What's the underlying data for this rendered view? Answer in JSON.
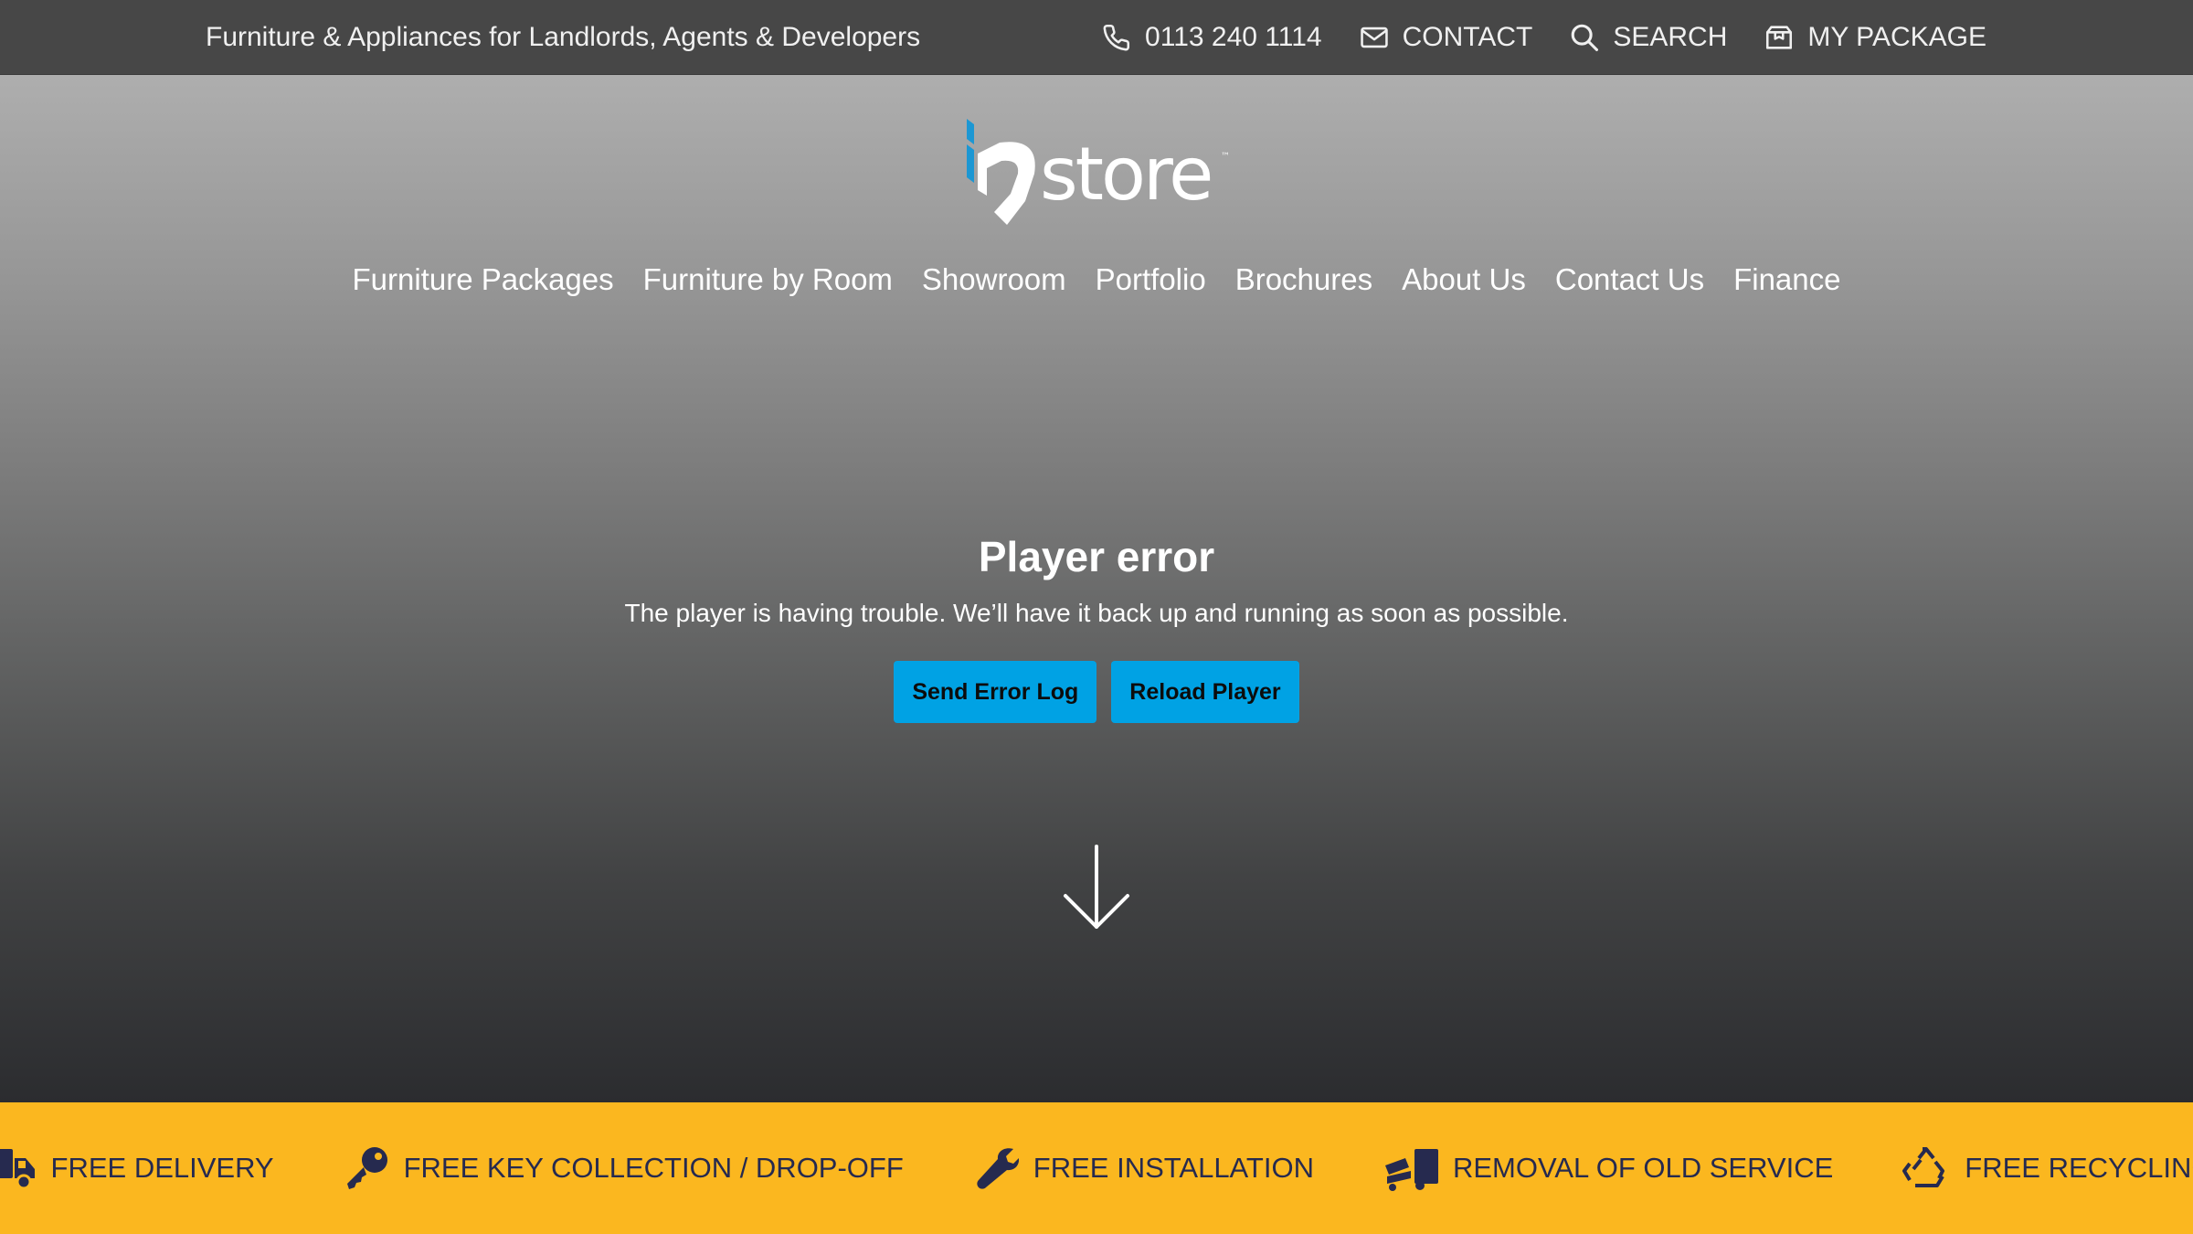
{
  "topbar": {
    "tagline": "Furniture & Appliances for Landlords, Agents & Developers",
    "phone": "0113 240 1114",
    "contact": "CONTACT",
    "search": "SEARCH",
    "package": "MY PACKAGE"
  },
  "logo": {
    "text": "store"
  },
  "nav": {
    "items": [
      "Furniture Packages",
      "Furniture by Room",
      "Showroom",
      "Portfolio",
      "Brochures",
      "About Us",
      "Contact Us",
      "Finance"
    ]
  },
  "player_error": {
    "title": "Player error",
    "message": "The player is having trouble. We’ll have it back up and running as soon as possible.",
    "send_log": "Send Error Log",
    "reload": "Reload Player"
  },
  "benefits": {
    "items": [
      "FREE DELIVERY",
      "FREE KEY COLLECTION / DROP-OFF",
      "FREE INSTALLATION",
      "REMOVAL OF OLD SERVICE",
      "FREE RECYCLING"
    ]
  },
  "colors": {
    "topbar": "#474747",
    "accent_blue": "#00a2e4",
    "benefits_bg": "#fbb71f",
    "benefits_text": "#262a4f"
  },
  "icons": [
    "phone-icon",
    "envelope-icon",
    "search-icon",
    "box-icon",
    "truck-icon",
    "key-icon",
    "wrench-icon",
    "removal-icon",
    "recycle-icon",
    "arrow-down-icon"
  ]
}
